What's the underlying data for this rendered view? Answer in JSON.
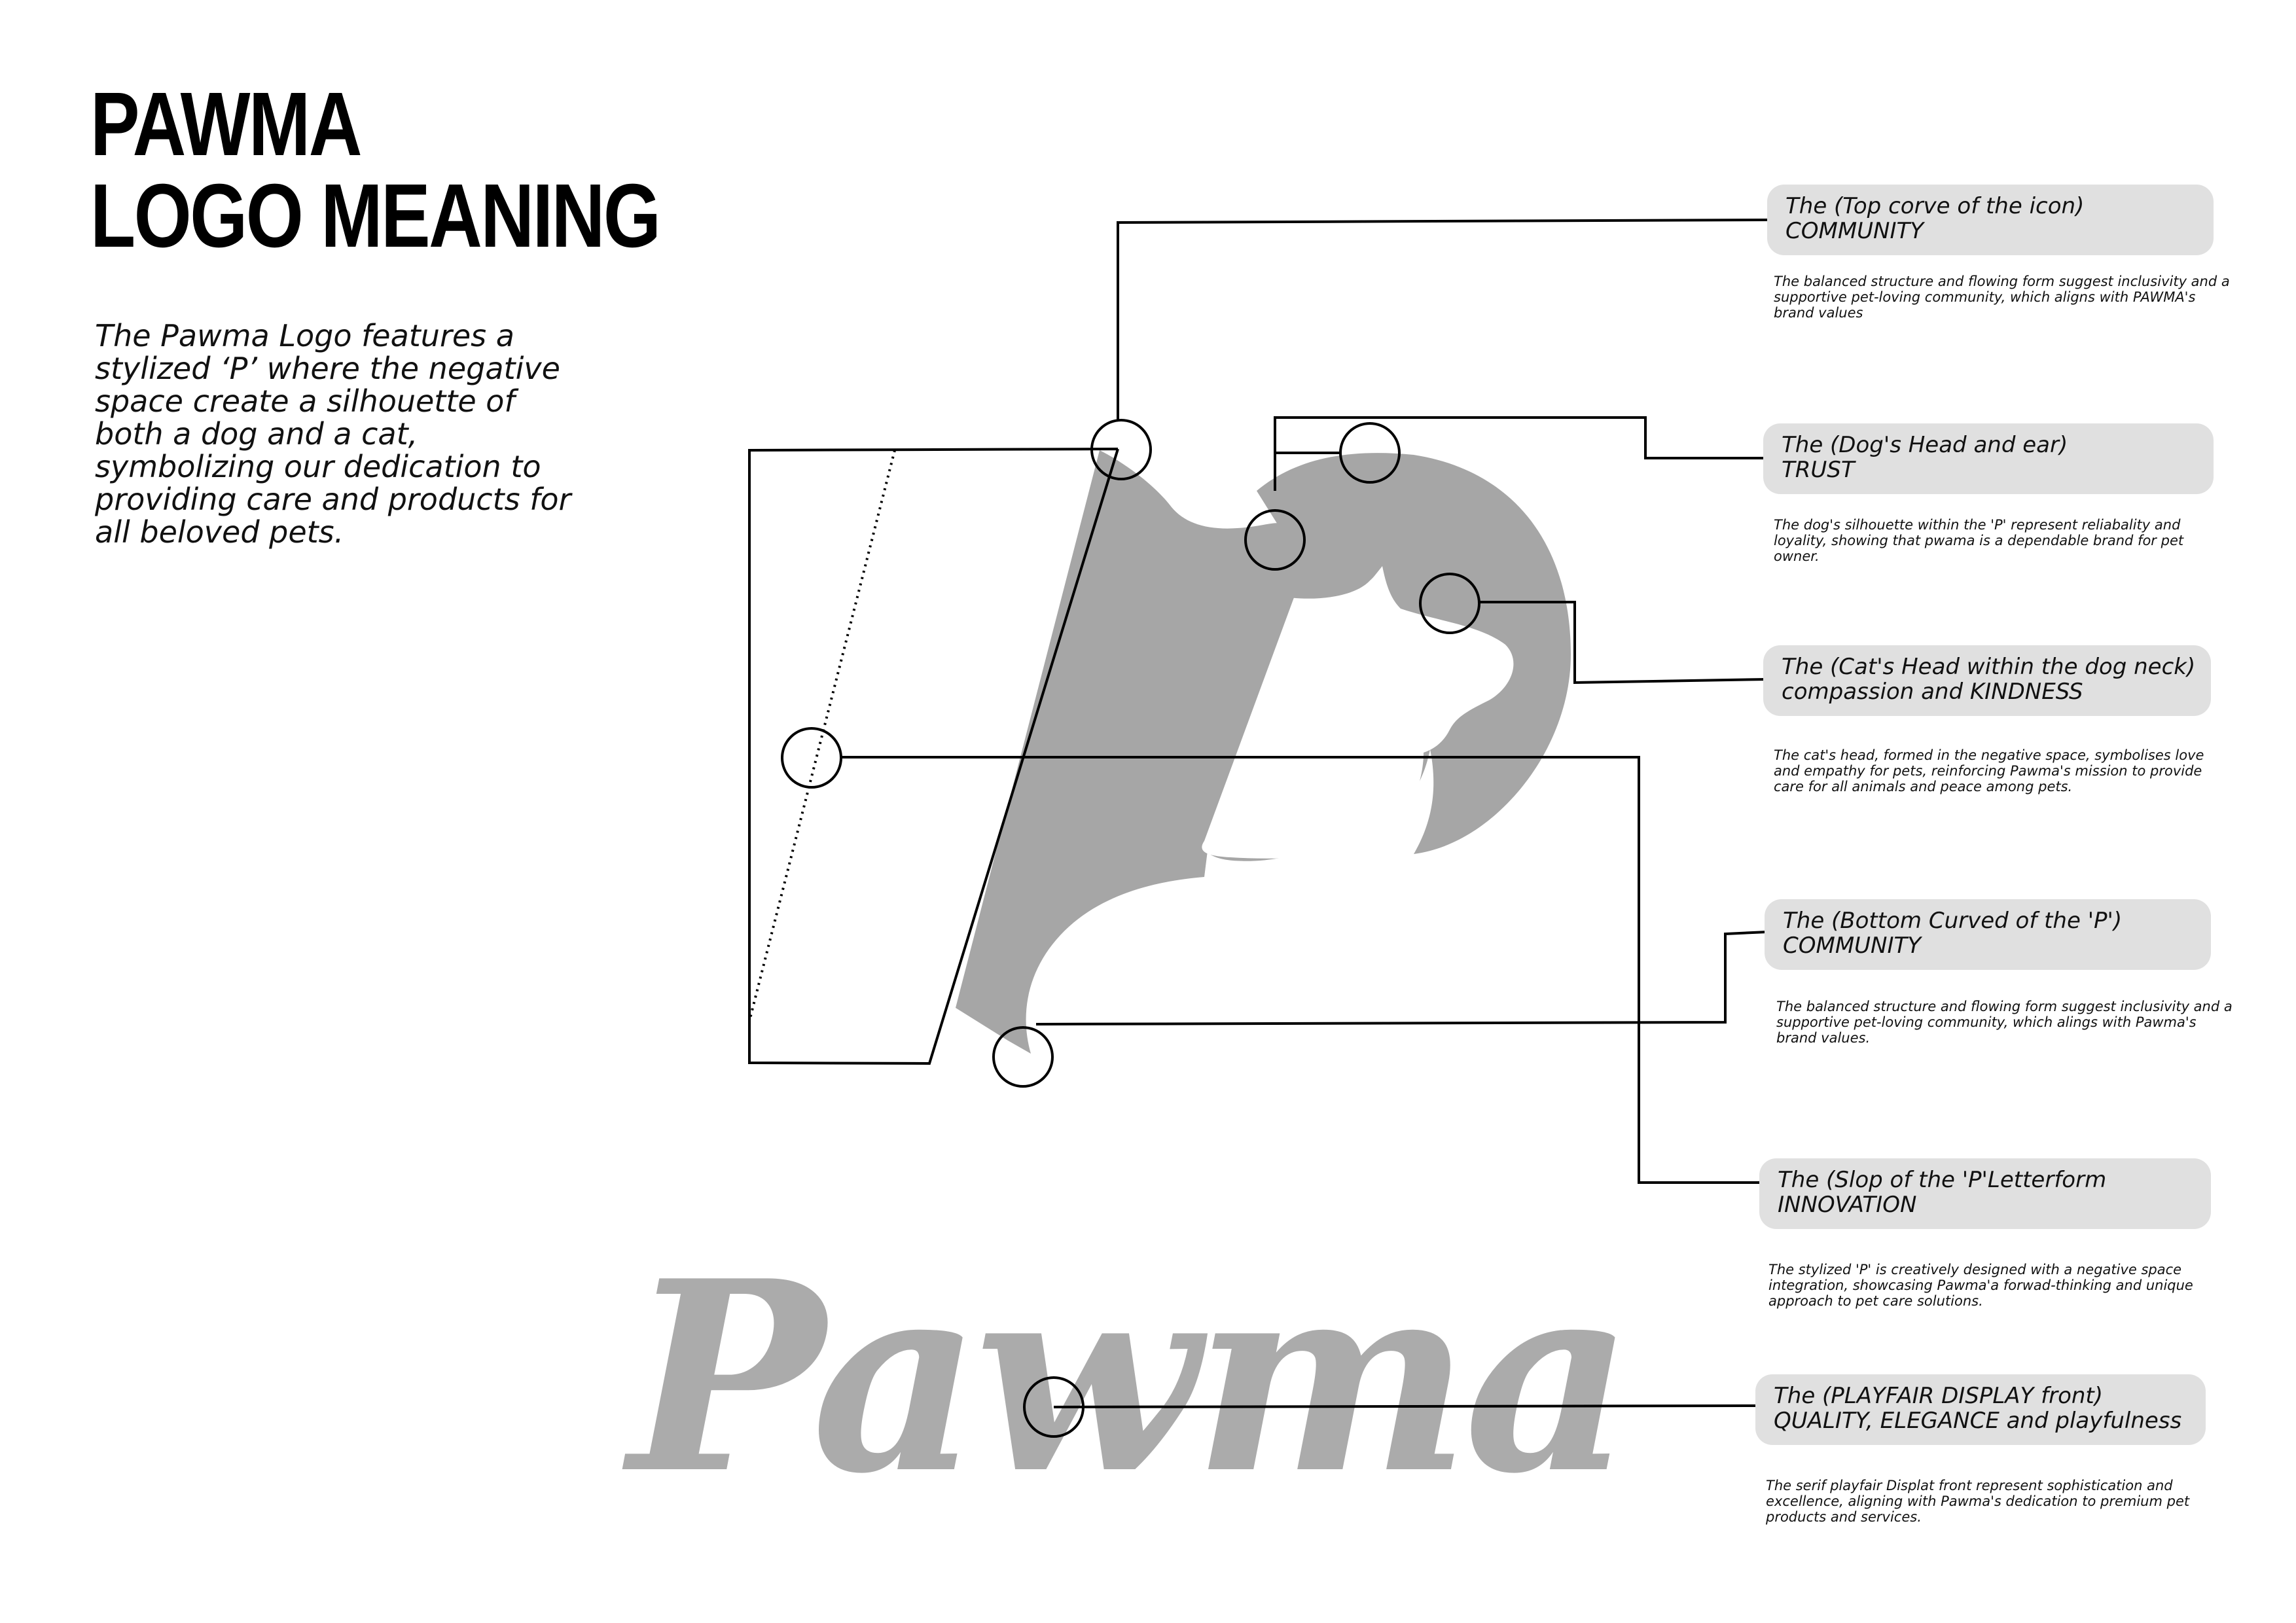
{
  "title": {
    "line1": "PAWMA",
    "line2": "LOGO MEANING"
  },
  "intro": "The Pawma Logo features a stylized ‘P’ where the negative space create a silhouette of both a dog and a cat, symbolizing our dedication to providing care and products for all beloved pets.",
  "wordmark": "Pawma",
  "colors": {
    "logo_fill": "#a6a6a6",
    "card_fill": "#e0e0e0",
    "line": "#000000"
  },
  "callouts": [
    {
      "heading": "The (Top corve of the icon)",
      "keyword": "COMMUNITY",
      "description": "The balanced structure and flowing form suggest inclusivity and a supportive pet-loving community, which aligns with PAWMA's brand values"
    },
    {
      "heading": "The (Dog's Head and ear)",
      "keyword": "TRUST",
      "description": "The dog's silhouette within the 'P' represent reliabality and loyality, showing that pwama is a dependable brand for pet owner."
    },
    {
      "heading": "The (Cat's Head within the dog neck)",
      "keyword": "compassion and KINDNESS",
      "description": "The cat's head, formed in the negative space, symbolises love and empathy for pets, reinforcing Pawma's mission to provide care for all animals and peace among pets."
    },
    {
      "heading": "The (Bottom Curved of the 'P')",
      "keyword": "COMMUNITY",
      "description": "The balanced structure and flowing form suggest inclusivity and a supportive pet-loving community, which alings with Pawma's brand values."
    },
    {
      "heading": "The (Slop of the 'P'Letterform",
      "keyword": "INNOVATION",
      "description": "The stylized 'P' is creatively designed with a negative space integration, showcasing Pawma'a forwad-thinking and unique approach to pet care solutions."
    },
    {
      "heading": "The (PLAYFAIR DISPLAY front)",
      "keyword": "QUALITY, ELEGANCE and playfulness",
      "description": "The serif playfair Displat front represent sophistication and excellence, aligning with Pawma's dedication to premium pet products and services."
    }
  ]
}
